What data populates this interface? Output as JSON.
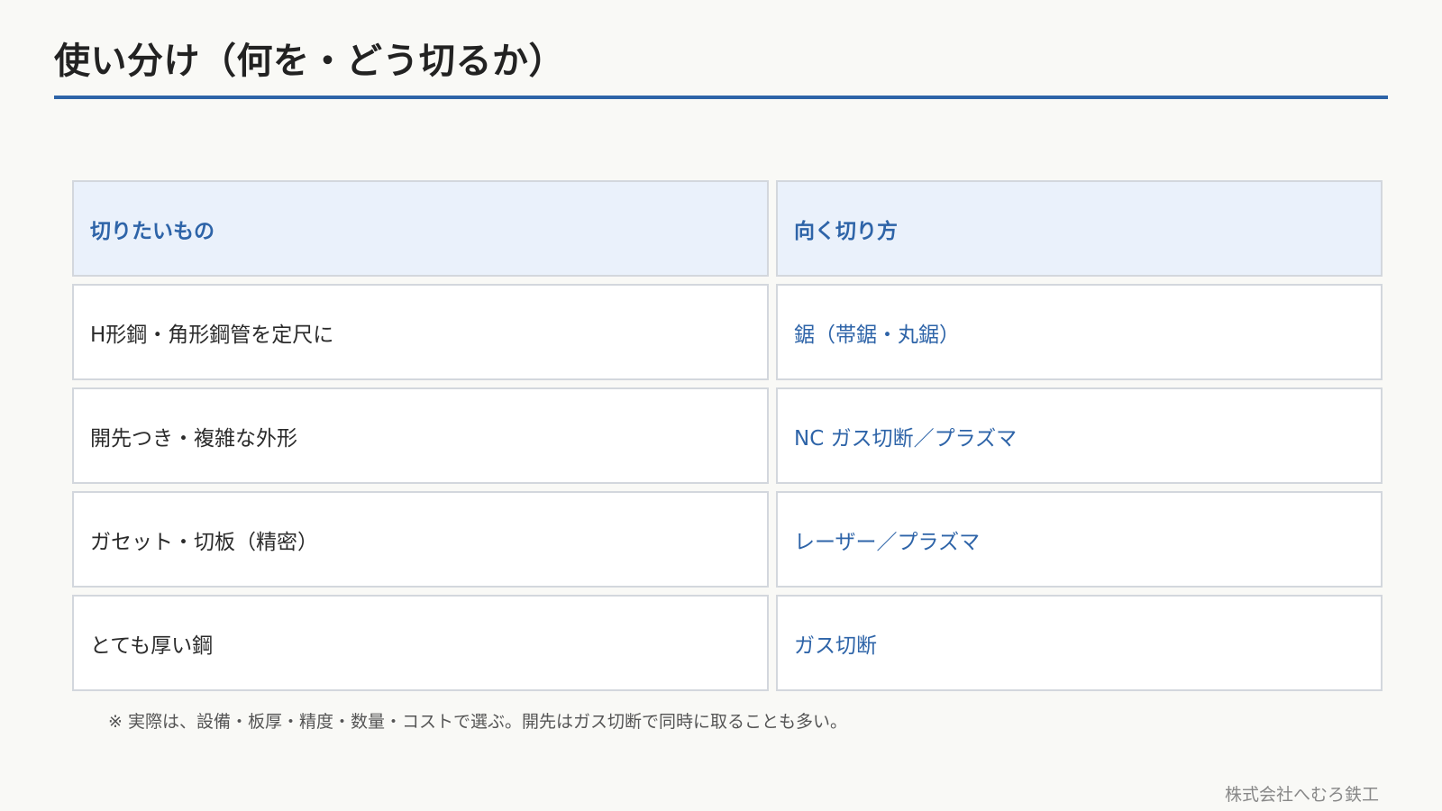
{
  "slide": {
    "title": "使い分け（何を・どう切るか）"
  },
  "table": {
    "headers": [
      "切りたいもの",
      "向く切り方"
    ],
    "rows": [
      [
        "H形鋼・角形鋼管を定尺に",
        "鋸（帯鋸・丸鋸）"
      ],
      [
        "開先つき・複雑な外形",
        "NC ガス切断／プラズマ"
      ],
      [
        "ガセット・切板（精密）",
        "レーザー／プラズマ"
      ],
      [
        "とても厚い鋼",
        "ガス切断"
      ]
    ]
  },
  "note": "※ 実際は、設備・板厚・精度・数量・コストで選ぶ。開先はガス切断で同時に取ることも多い。",
  "footer": "株式会社へむろ鉄工",
  "colors": {
    "accent": "#2e64a8",
    "header_bg": "#eaf1fb",
    "background": "#f9f9f6"
  }
}
